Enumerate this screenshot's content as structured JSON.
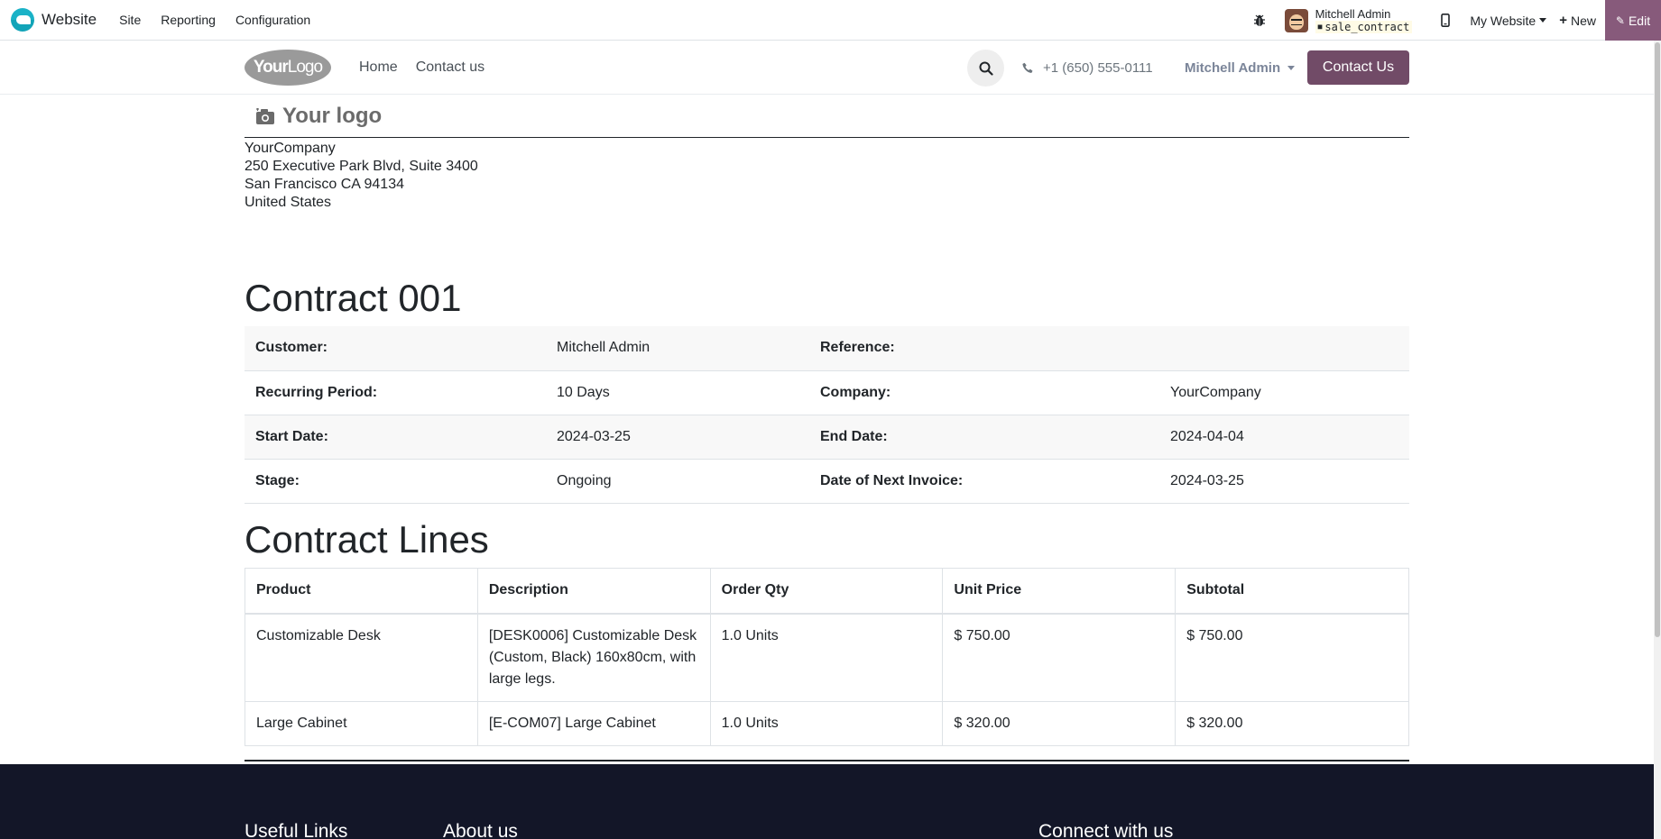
{
  "admin_bar": {
    "brand": "Website",
    "menu": [
      "Site",
      "Reporting",
      "Configuration"
    ],
    "user_name": "Mitchell Admin",
    "database": "sale_contract",
    "website_selector": "My Website",
    "new_label": "New",
    "edit_label": "Edit",
    "accent_color": "#875a7b"
  },
  "site_header": {
    "logo_text_bold": "Your",
    "logo_text_light": "Logo",
    "nav": [
      "Home",
      "Contact us"
    ],
    "phone": "+1 (650) 555-0111",
    "user": "Mitchell Admin",
    "cta": "Contact Us",
    "cta_color": "#714b67"
  },
  "report": {
    "logo_placeholder": "Your logo",
    "company_address": [
      "YourCompany",
      "250 Executive Park Blvd, Suite 3400",
      "San Francisco CA 94134",
      "United States"
    ],
    "title": "Contract 001",
    "info": [
      [
        "Customer:",
        "Mitchell Admin",
        "Reference:",
        ""
      ],
      [
        "Recurring Period:",
        "10 Days",
        "Company:",
        "YourCompany"
      ],
      [
        "Start Date:",
        "2024-03-25",
        "End Date:",
        "2024-04-04"
      ],
      [
        "Stage:",
        "Ongoing",
        "Date of Next Invoice:",
        "2024-03-25"
      ]
    ],
    "lines_title": "Contract Lines",
    "lines_headers": [
      "Product",
      "Description",
      "Order Qty",
      "Unit Price",
      "Subtotal"
    ],
    "lines": [
      [
        "Customizable Desk",
        "[DESK0006] Customizable Desk (Custom, Black) 160x80cm, with large legs.",
        "1.0 Units",
        "$ 750.00",
        "$ 750.00"
      ],
      [
        "Large Cabinet",
        "[E-COM07] Large Cabinet",
        "1.0 Units",
        "$ 320.00",
        "$ 320.00"
      ]
    ]
  },
  "footer": {
    "headings": [
      "Useful Links",
      "About us",
      "Connect with us"
    ],
    "background": "#131628"
  },
  "icons": [
    "bug-icon",
    "device-icon",
    "search-icon",
    "phone-icon",
    "camera-icon",
    "database-icon"
  ]
}
